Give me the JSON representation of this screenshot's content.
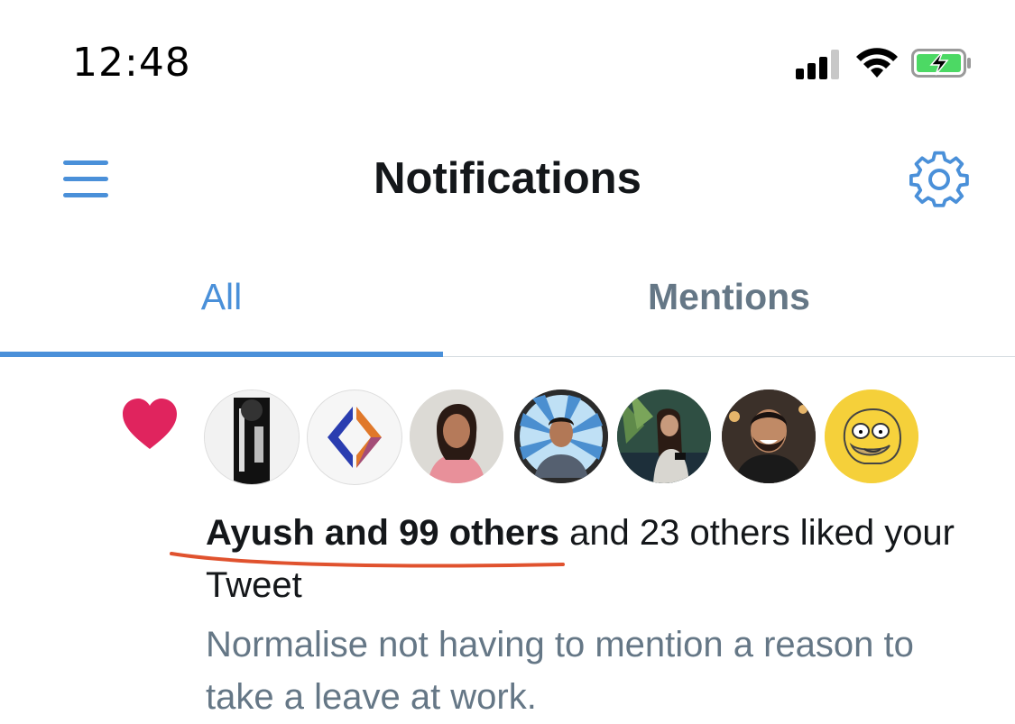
{
  "status_bar": {
    "time": "12:48"
  },
  "header": {
    "title": "Notifications",
    "accent_color": "#4a90d9"
  },
  "tabs": [
    {
      "label": "All",
      "active": true
    },
    {
      "label": "Mentions",
      "active": false
    }
  ],
  "notification": {
    "icon": "heart-icon",
    "avatars": [
      {
        "description": "black-and-white portrait"
      },
      {
        "description": "orange and blue code-bracket logo"
      },
      {
        "description": "woman in pink top"
      },
      {
        "description": "man with blue sunburst background"
      },
      {
        "description": "woman on phone with plants"
      },
      {
        "description": "smiling man with beard"
      },
      {
        "description": "cartoon character on yellow"
      }
    ],
    "actor_bold": "Ayush and 99 others",
    "action_text": " and 23 others liked your Tweet",
    "tweet_text": "Normalise not having to mention a reason to take a leave at work."
  }
}
